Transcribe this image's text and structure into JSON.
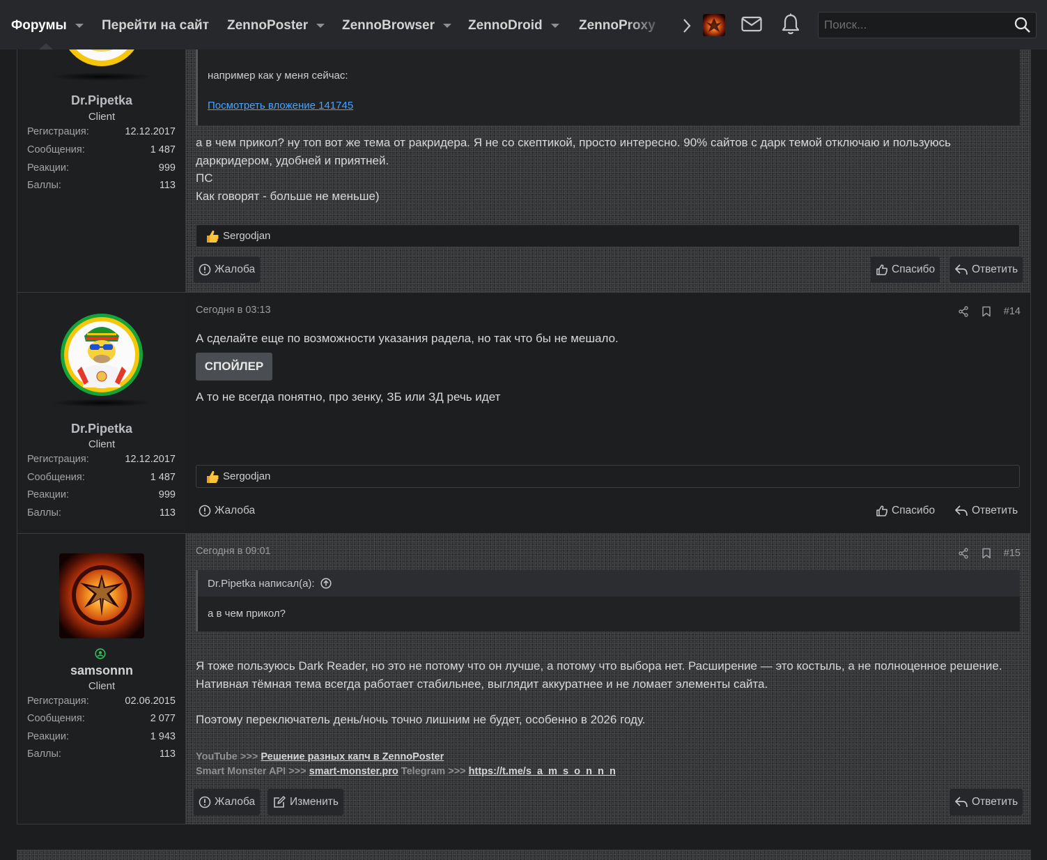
{
  "nav": {
    "items": [
      {
        "label": "Форумы",
        "caret": true
      },
      {
        "label": "Перейти на сайт",
        "caret": false
      },
      {
        "label": "ZennoPoster",
        "caret": true
      },
      {
        "label": "ZennoBrowser",
        "caret": true
      },
      {
        "label": "ZennoDroid",
        "caret": true
      },
      {
        "label": "ZennoProxy",
        "caret": false
      }
    ],
    "search_placeholder": "Поиск..."
  },
  "posts": [
    {
      "username": "Dr.Pipetka",
      "title": "Client",
      "stats": [
        {
          "k": "Регистрация:",
          "v": "12.12.2017"
        },
        {
          "k": "Сообщения:",
          "v": "1 487"
        },
        {
          "k": "Реакции:",
          "v": "999"
        },
        {
          "k": "Баллы:",
          "v": "113"
        }
      ],
      "quote_text": "например как у меня сейчас:",
      "quote_link": "Посмотреть вложение 141745",
      "body": [
        "а в чем прикол? ну топ вот же тема от ракридера. Я не со скептикой, просто интересно. 90% сайтов с дарк темой отключаю и пользуюсь даркридером, удобней и приятней.",
        "ПС",
        "Как говорят - больше не меньше)"
      ],
      "reaction_user": "Sergodjan",
      "report": "Жалоба",
      "thanks": "Спасибо",
      "reply": "Ответить"
    },
    {
      "username": "Dr.Pipetka",
      "title": "Client",
      "date": "Сегодня в 03:13",
      "number": "#14",
      "stats": [
        {
          "k": "Регистрация:",
          "v": "12.12.2017"
        },
        {
          "k": "Сообщения:",
          "v": "1 487"
        },
        {
          "k": "Реакции:",
          "v": "999"
        },
        {
          "k": "Баллы:",
          "v": "113"
        }
      ],
      "body1": "А сделайте еще по возможности указания радела, но так что бы не мешало.",
      "spoiler": "СПОЙЛЕР",
      "body2": "А то не всегда понятно, про зенку, ЗБ или ЗД речь идет",
      "reaction_user": "Sergodjan",
      "report": "Жалоба",
      "thanks": "Спасибо",
      "reply": "Ответить"
    },
    {
      "username": "samsonnn",
      "title": "Client",
      "date": "Сегодня в 09:01",
      "number": "#15",
      "stats": [
        {
          "k": "Регистрация:",
          "v": "02.06.2015"
        },
        {
          "k": "Сообщения:",
          "v": "2 077"
        },
        {
          "k": "Реакции:",
          "v": "1 943"
        },
        {
          "k": "Баллы:",
          "v": "113"
        }
      ],
      "quote_author": "Dr.Pipetka написал(а):",
      "quote_text": "а в чем прикол?",
      "body1": "Я тоже пользуюсь Dark Reader, но это не потому что он лучше, а потому что выбора нет. Расширение — это костыль, а не полноценное решение. Нативная тёмная тема всегда работает стабильнее, выглядит аккуратнее и не ломает элементы сайта.",
      "body2": "Поэтому переключатель день/ночь точно лишним не будет, особенно в 2026 году.",
      "sig": {
        "youtube_prefix": "YouTube >>> ",
        "youtube_link": "Решение разных капч в ZennoPoster",
        "api_prefix": "Smart Monster API >>> ",
        "api_link": "smart-monster.pro",
        "tg_prefix": " Telegram >>> ",
        "tg_link": "https://t.me/s_a_m_s_o_n_n_n"
      },
      "report": "Жалоба",
      "edit": "Изменить",
      "reply": "Ответить"
    }
  ],
  "colors": {
    "accent_link": "#4aa3ff",
    "avatar_yellow": "#f5c60a",
    "avatar_green": "#15a43a"
  }
}
